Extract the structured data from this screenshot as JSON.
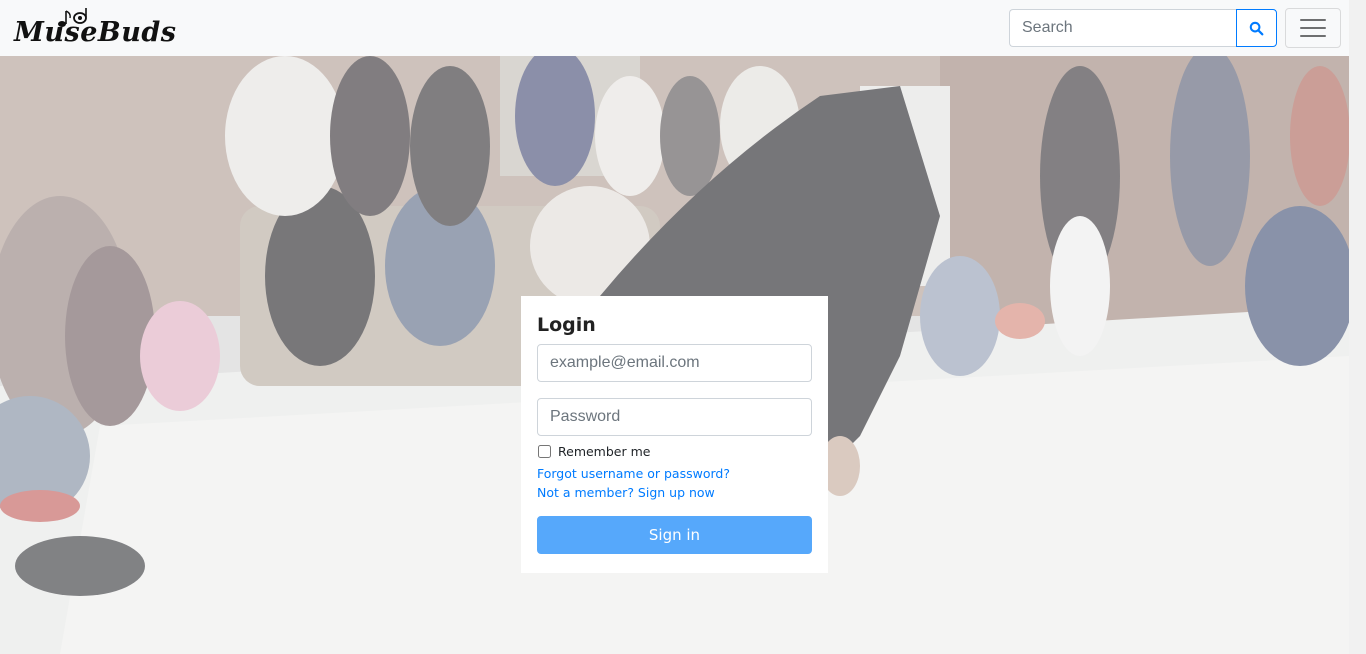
{
  "brand": {
    "name": "MuseBuds"
  },
  "navbar": {
    "search_placeholder": "Search",
    "search_button_icon": "search-icon",
    "menu_icon": "hamburger-menu-icon"
  },
  "login": {
    "title": "Login",
    "email_placeholder": "example@email.com",
    "password_placeholder": "Password",
    "remember_label": "Remember me",
    "remember_checked": false,
    "forgot_link": "Forgot username or password?",
    "signup_link": "Not a member? Sign up now",
    "signin_label": "Sign in"
  },
  "colors": {
    "primary": "#007bff",
    "signin_button": "#56a8fb",
    "navbar_bg": "#f8f9fa"
  }
}
